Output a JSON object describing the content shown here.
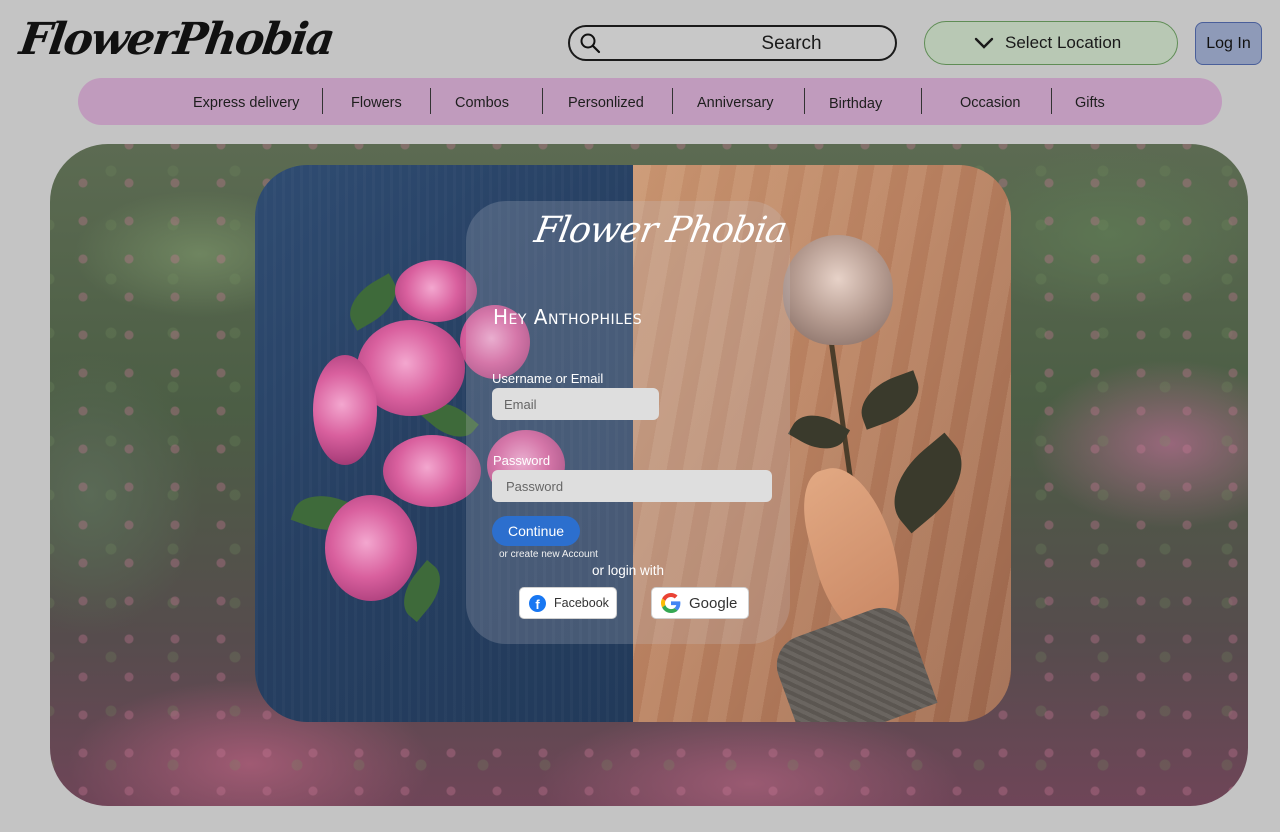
{
  "header": {
    "logo": "FlowerPhobia",
    "search_label": "Search",
    "location_label": "Select Location",
    "login_label": "Log In"
  },
  "nav": {
    "items": [
      "Express delivery",
      "Flowers",
      "Combos",
      "Personlized",
      "Anniversary",
      "Birthday",
      "Occasion",
      "Gifts"
    ]
  },
  "login_card": {
    "brand": "Flower Phobia",
    "greeting": "Hey Anthophiles",
    "username_label": "Username or Email",
    "email_placeholder": "Email",
    "password_label": "Password",
    "password_placeholder": "Password",
    "continue_label": "Continue",
    "create_account_text": "or create new Account",
    "or_login_with": "or login with",
    "facebook_label": "Facebook",
    "google_label": "Google"
  },
  "colors": {
    "nav_bg": "#c09bbd",
    "location_bg": "#b8c8b4",
    "login_bg": "#8e9ab8",
    "continue_bg": "#2c6fce",
    "facebook_blue": "#1877f2"
  },
  "icons": [
    "search-icon",
    "chevron-down-icon",
    "facebook-icon",
    "google-icon"
  ]
}
